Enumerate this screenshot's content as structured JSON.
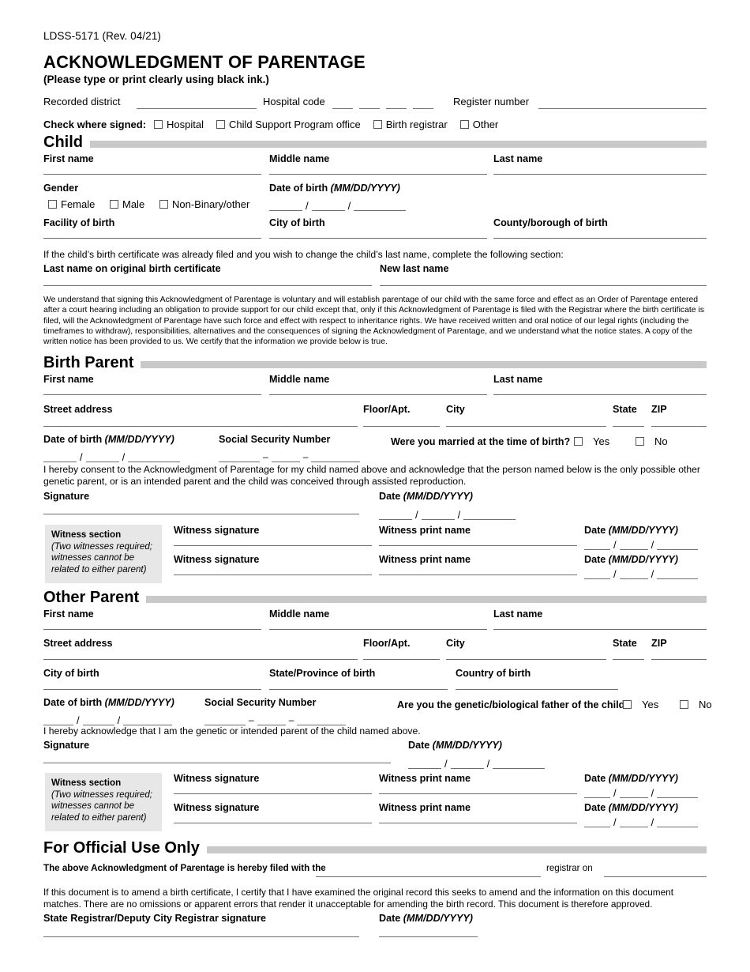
{
  "form": {
    "number": "LDSS-5171 (Rev. 04/21)",
    "title": "ACKNOWLEDGMENT OF PARENTAGE",
    "subtitle": "(Please type or print clearly using black ink.)"
  },
  "header": {
    "recorded_district": "Recorded district",
    "hospital_code": "Hospital code",
    "register_number": "Register number",
    "check_where_signed": "Check where signed:",
    "signed_options": [
      "Hospital",
      "Child Support Program office",
      "Birth registrar",
      "Other"
    ]
  },
  "child": {
    "heading": "Child",
    "first_name": "First name",
    "middle_name": "Middle name",
    "last_name": "Last name",
    "gender": "Gender",
    "gender_options": [
      "Female",
      "Male",
      "Non-Binary/other"
    ],
    "dob_label": "Date of birth",
    "dob_format": "(MM/DD/YYYY)",
    "facility_of_birth": "Facility of birth",
    "city_of_birth": "City of birth",
    "county_of_birth": "County/borough of birth",
    "namechange_intro": "If the child’s birth certificate was already filed and you wish to change the child’s last name, complete the following section:",
    "last_name_original": "Last name on original birth certificate",
    "new_last_name": "New last name"
  },
  "understanding": "We understand that signing this Acknowledgment of Parentage is voluntary and will establish parentage of our child with the same force and effect as an Order of Parentage entered after a court hearing including an obligation to provide support for our child except that, only if this Acknowledgment of Parentage is filed with the Registrar where the birth certificate is filed, will the Acknowledgment of Parentage have such force and effect with respect to inheritance rights. We have received written and oral notice of our legal rights (including the timeframes to withdraw), responsibilities, alternatives and the consequences of signing the Acknowledgment of Parentage, and we understand what the notice states. A copy of the written notice has been provided to us. We certify that the information we provide below is true.",
  "birth_parent": {
    "heading": "Birth Parent",
    "first_name": "First name",
    "middle_name": "Middle name",
    "last_name": "Last name",
    "street_address": "Street address",
    "floor_apt": "Floor/Apt.",
    "city": "City",
    "state": "State",
    "zip": "ZIP",
    "dob_label": "Date of birth",
    "dob_format": "(MM/DD/YYYY)",
    "ssn": "Social Security Number",
    "married_question": "Were you married at the time of birth?",
    "yes": "Yes",
    "no": "No",
    "consent": "I hereby consent to the Acknowledgment of Parentage for my child named above and acknowledge that the person named below is the only possible other genetic parent, or is an intended parent and the child was conceived through assisted reproduction.",
    "signature": "Signature",
    "date_label": "Date",
    "date_format": "(MM/DD/YYYY)"
  },
  "witness": {
    "title": "Witness section",
    "note_line1": "(Two witnesses required;",
    "note_line2": "witnesses cannot be",
    "note_line3": "related to either parent)",
    "signature": "Witness signature",
    "print_name": "Witness print name",
    "date_label": "Date",
    "date_format": "(MM/DD/YYYY)"
  },
  "other_parent": {
    "heading": "Other Parent",
    "first_name": "First name",
    "middle_name": "Middle name",
    "last_name": "Last name",
    "street_address": "Street address",
    "floor_apt": "Floor/Apt.",
    "city": "City",
    "state": "State",
    "zip": "ZIP",
    "city_of_birth": "City of birth",
    "state_province_of_birth": "State/Province of birth",
    "country_of_birth": "Country of birth",
    "dob_label": "Date of birth",
    "dob_format": "(MM/DD/YYYY)",
    "ssn": "Social Security Number",
    "father_question": "Are you the genetic/biological father of the child?",
    "yes": "Yes",
    "no": "No",
    "acknowledge": "I hereby acknowledge that I am the genetic or intended parent of the child named above.",
    "signature": "Signature",
    "date_label": "Date",
    "date_format": "(MM/DD/YYYY)"
  },
  "official": {
    "heading": "For Official Use Only",
    "filed_with_prefix": "The above Acknowledgment of Parentage is hereby filed with the",
    "filed_with_suffix": "registrar on",
    "amend_text": "If this document is to amend a birth certificate, I certify that I have examined the original record this seeks to amend and the information on this document matches. There are no omissions or apparent errors that render it unacceptable for amending the birth record. This document is therefore approved.",
    "registrar_signature": "State Registrar/Deputy City Registrar signature",
    "date_label": "Date",
    "date_format": "(MM/DD/YYYY)"
  },
  "colors": {
    "section_bar": "#c9c9c9",
    "witness_box": "#e7e7e7",
    "rule": "#6e6e6e"
  }
}
